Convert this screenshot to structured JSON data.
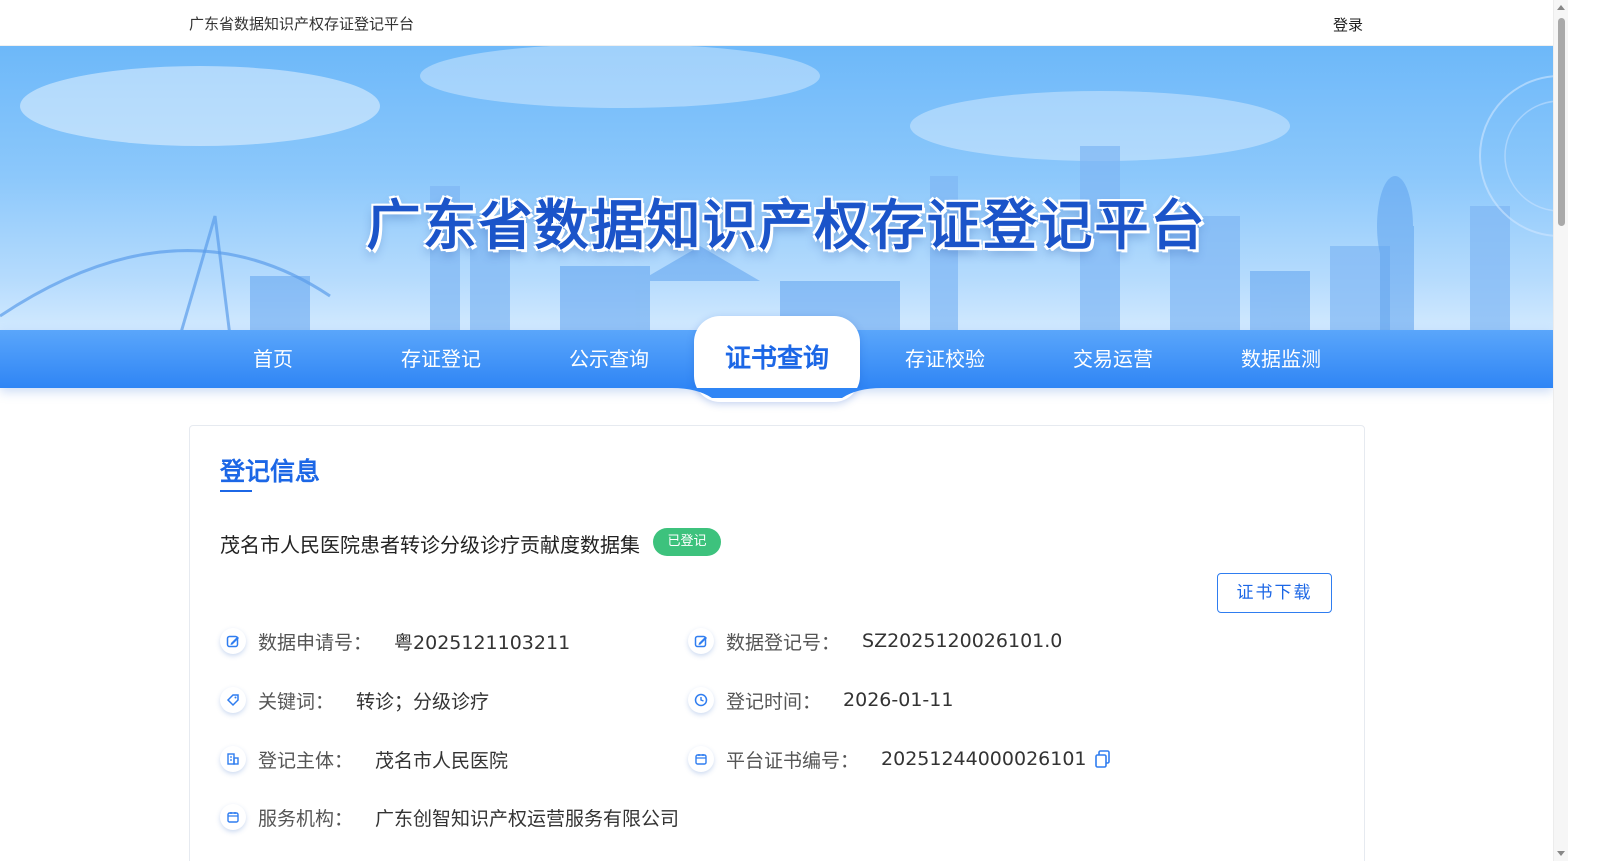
{
  "topbar": {
    "site_name": "广东省数据知识产权存证登记平台",
    "login": "登录"
  },
  "banner": {
    "title": "广东省数据知识产权存证登记平台"
  },
  "nav": {
    "items": [
      {
        "label": "首页"
      },
      {
        "label": "存证登记"
      },
      {
        "label": "公示查询"
      },
      {
        "label": "证书查询",
        "active": true
      },
      {
        "label": "存证校验"
      },
      {
        "label": "交易运营"
      },
      {
        "label": "数据监测"
      }
    ]
  },
  "section": {
    "title": "登记信息"
  },
  "record": {
    "name": "茂名市人民医院患者转诊分级诊疗贡献度数据集",
    "status": "已登记",
    "download": "证书下载"
  },
  "fields": {
    "application_no": {
      "label": "数据申请号：",
      "value": "粤2025121103211",
      "icon": "edit-icon"
    },
    "registration_no": {
      "label": "数据登记号：",
      "value": "SZ2025120026101.0",
      "icon": "edit-icon"
    },
    "keywords": {
      "label": "关键词：",
      "value": "转诊；分级诊疗",
      "icon": "tag-icon"
    },
    "register_time": {
      "label": "登记时间：",
      "value": "2026-01-11",
      "icon": "clock-icon"
    },
    "subject": {
      "label": "登记主体：",
      "value": "茂名市人民医院",
      "icon": "building-icon"
    },
    "cert_no": {
      "label": "平台证书编号：",
      "value": "20251244000026101",
      "icon": "calendar-icon"
    },
    "agency": {
      "label": "服务机构：",
      "value": "广东创智知识产权运营服务有限公司",
      "icon": "calendar-icon"
    }
  },
  "colors": {
    "accent": "#1c67e6",
    "nav": "#2f85f5",
    "badge": "#3dc27d"
  }
}
